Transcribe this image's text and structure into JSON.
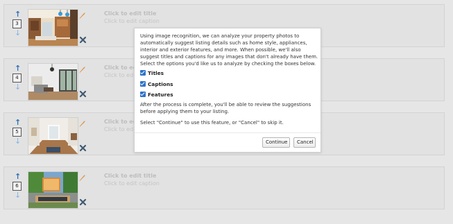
{
  "photos": [
    {
      "order": "3",
      "title": "Click to edit title",
      "caption": "Click to edit caption",
      "theme": "kitchen"
    },
    {
      "order": "4",
      "title": "Click to edit title",
      "caption": "Click to edit caption",
      "theme": "living"
    },
    {
      "order": "5",
      "title": "Click to edit title",
      "caption": "Click to edit caption",
      "theme": "hallway"
    },
    {
      "order": "6",
      "title": "Click to edit title",
      "caption": "Click to edit caption",
      "theme": "patio"
    }
  ],
  "modal": {
    "intro": "Using image recognition, we can analyze your property photos to automatically suggest listing details such as home style, appliances, interior and exterior features, and more. When possible, we'll also suggest titles and captions for any images that don't already have them. Select the options you'd like us to analyze by checking the boxes below.",
    "options": [
      {
        "label": "Titles",
        "checked": true
      },
      {
        "label": "Captions",
        "checked": true
      },
      {
        "label": "Features",
        "checked": true
      }
    ],
    "after_process": "After the process is complete, you'll be able to review the suggestions before applying them to your listing.",
    "select_note": "Select \"Continue\" to use this feature, or \"Cancel\" to skip it.",
    "continue_label": "Continue",
    "cancel_label": "Cancel"
  },
  "colors": {
    "accent": "#2d73c9",
    "pencil": "#e08a3a",
    "delete": "#3f5a73"
  }
}
